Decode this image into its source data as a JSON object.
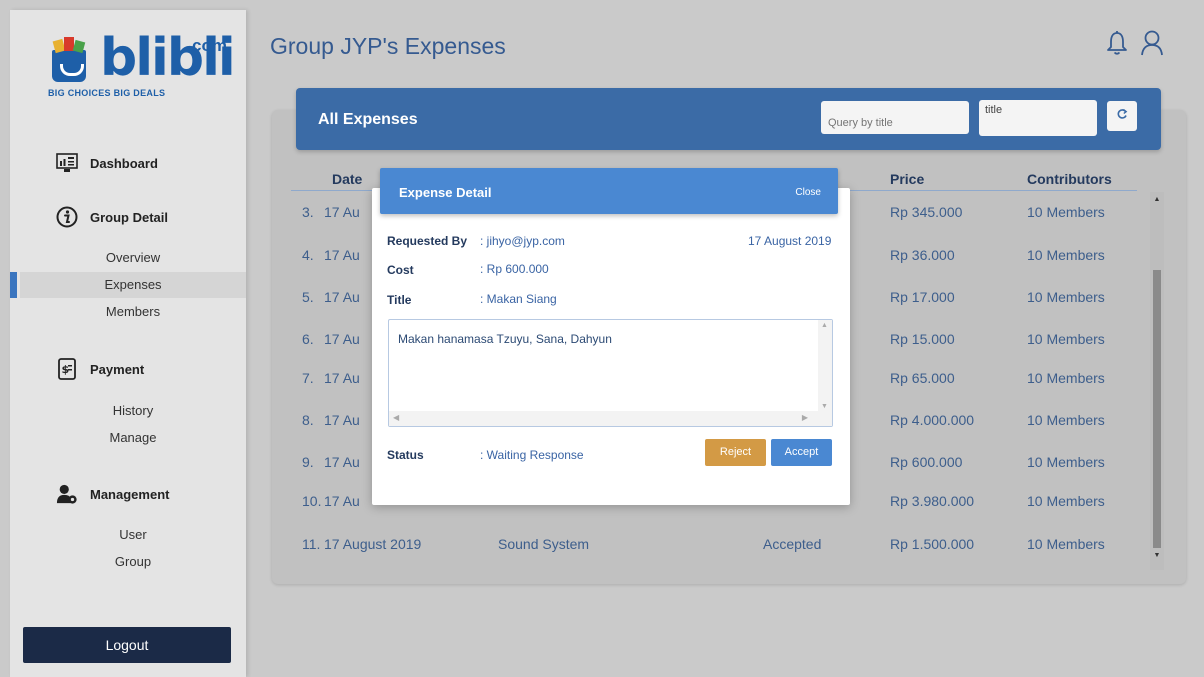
{
  "brand": {
    "name": "blibli",
    "suffix": "com",
    "tagline": "BIG CHOICES  BIG DEALS"
  },
  "sidebar": {
    "sections": [
      {
        "label": "Dashboard",
        "icon": "dashboard-icon"
      },
      {
        "label": "Group Detail",
        "icon": "info-icon"
      },
      {
        "label": "Payment",
        "icon": "payment-icon"
      },
      {
        "label": "Management",
        "icon": "management-icon"
      }
    ],
    "group_detail_items": [
      "Overview",
      "Expenses",
      "Members"
    ],
    "payment_items": [
      "History",
      "Manage"
    ],
    "management_items": [
      "User",
      "Group"
    ],
    "active_item": "Expenses",
    "logout_label": "Logout"
  },
  "header": {
    "title": "Group JYP's Expenses",
    "icons": [
      "bell-icon",
      "user-icon"
    ]
  },
  "expenses": {
    "title": "All Expenses",
    "search_placeholder": "Query by title",
    "sort_field": "title",
    "columns": {
      "date": "Date",
      "price": "Price",
      "contributors": "Contributors"
    },
    "rows": [
      {
        "no": "3.",
        "date": "17 Au",
        "price": "Rp 345.000",
        "contributors": "10 Members"
      },
      {
        "no": "4.",
        "date": "17 Au",
        "price": "Rp 36.000",
        "contributors": "10 Members"
      },
      {
        "no": "5.",
        "date": "17 Au",
        "price": "Rp 17.000",
        "contributors": "10 Members"
      },
      {
        "no": "6.",
        "date": "17 Au",
        "price": "Rp 15.000",
        "contributors": "10 Members"
      },
      {
        "no": "7.",
        "date": "17 Au",
        "price": "Rp 65.000",
        "contributors": "10 Members"
      },
      {
        "no": "8.",
        "date": "17 Au",
        "price": "Rp 4.000.000",
        "contributors": "10 Members"
      },
      {
        "no": "9.",
        "date": "17 Au",
        "price": "Rp 600.000",
        "contributors": "10 Members"
      },
      {
        "no": "10.",
        "date": "17 Au",
        "price": "Rp 3.980.000",
        "contributors": "10 Members"
      },
      {
        "no": "11.",
        "date": "17 August 2019",
        "title": "Sound System",
        "status": "Accepted",
        "price": "Rp 1.500.000",
        "contributors": "10 Members"
      }
    ]
  },
  "modal": {
    "title": "Expense Detail",
    "close_label": "Close",
    "requested_by_label": "Requested By",
    "requested_by": ": jihyo@jyp.com",
    "date": "17 August 2019",
    "cost_label": "Cost",
    "cost": ": Rp 600.000",
    "title_label": "Title",
    "title_value": ": Makan Siang",
    "description": "Makan hanamasa Tzuyu, Sana, Dahyun",
    "status_label": "Status",
    "status": ": Waiting Response",
    "reject_label": "Reject",
    "accept_label": "Accept"
  },
  "colors": {
    "primary": "#3b6ba6",
    "modal_header": "#4a88d2",
    "reject": "#d39a45",
    "logout": "#1b2a47"
  }
}
